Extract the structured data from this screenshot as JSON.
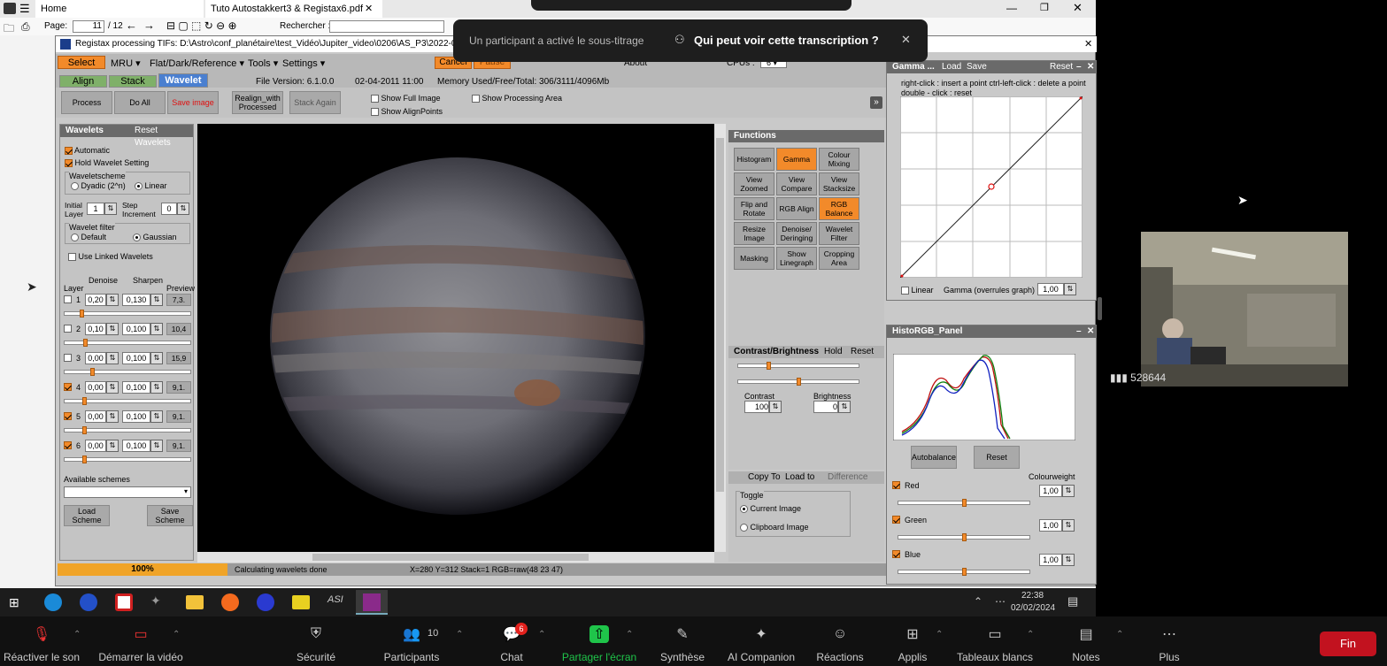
{
  "pdf": {
    "tabs": [
      {
        "label": "Home"
      },
      {
        "label": "Tuto Autostakkert3 & Registax6.pdf"
      }
    ],
    "page_label": "Page:",
    "page_value": "11",
    "page_total": "/ 12",
    "search_label": "Rechercher :"
  },
  "registax": {
    "title": "Registax processing TIFs: D:\\Astro\\conf_planétaire\\test_Vidéo\\Jupiter_video\\0206\\AS_P3\\2022-09-22",
    "menu": {
      "select": "Select",
      "mru": "MRU",
      "flat": "Flat/Dark/Reference",
      "tools": "Tools",
      "settings": "Settings",
      "cancel": "Cancel",
      "pause": "Pause",
      "about": "About",
      "cpus": "CPUs :",
      "cpus_value": "6"
    },
    "tabs": {
      "align": "Align",
      "stack": "Stack",
      "wavelet": "Wavelet"
    },
    "file_version": "File Version: 6.1.0.0",
    "date": "02-04-2011 11:00",
    "memory": "Memory Used/Free/Total: 306/3111/4096Mb",
    "toolbar": {
      "process": "Process",
      "do_all": "Do All",
      "save_image": "Save image",
      "realign1": "Realign_with",
      "realign2": "Processed",
      "stack_again": "Stack Again",
      "show_full": "Show Full Image",
      "show_align": "Show AlignPoints",
      "show_processing": "Show Processing Area"
    },
    "wavelets": {
      "title": "Wavelets",
      "reset": "Reset Wavelets",
      "automatic": "Automatic",
      "hold": "Hold Wavelet Setting",
      "scheme_title": "Waveletscheme",
      "dyadic": "Dyadic (2^n)",
      "linear": "Linear",
      "initial1": "Initial",
      "initial2": "Layer",
      "initial_value": "1",
      "step1": "Step",
      "step2": "Increment",
      "step_value": "0",
      "filter_title": "Wavelet filter",
      "default": "Default",
      "gaussian": "Gaussian",
      "use_linked": "Use Linked Wavelets",
      "col_layer": "Layer",
      "col_denoise": "Denoise",
      "col_sharpen": "Sharpen",
      "col_preview": "Preview",
      "layers": [
        {
          "n": "1",
          "denoise": "0,20",
          "sharpen": "0,130",
          "preview": "7,3.",
          "checked": false,
          "slider": 0.12
        },
        {
          "n": "2",
          "denoise": "0,10",
          "sharpen": "0,100",
          "preview": "10,4",
          "checked": false,
          "slider": 0.15
        },
        {
          "n": "3",
          "denoise": "0,00",
          "sharpen": "0,100",
          "preview": "15,9",
          "checked": false,
          "slider": 0.21
        },
        {
          "n": "4",
          "denoise": "0,00",
          "sharpen": "0,100",
          "preview": "9,1.",
          "checked": true,
          "slider": 0.14
        },
        {
          "n": "5",
          "denoise": "0,00",
          "sharpen": "0,100",
          "preview": "9,1.",
          "checked": true,
          "slider": 0.14
        },
        {
          "n": "6",
          "denoise": "0,00",
          "sharpen": "0,100",
          "preview": "9,1.",
          "checked": true,
          "slider": 0.14
        }
      ],
      "available": "Available schemes",
      "load1": "Load",
      "load2": "Scheme",
      "save1": "Save",
      "save2": "Scheme"
    },
    "functions": {
      "title": "Functions",
      "buttons": [
        [
          "Histogram",
          "Gamma",
          "Colour Mixing"
        ],
        [
          "View Zoomed",
          "View Compare",
          "View Stacksize"
        ],
        [
          "Flip and Rotate",
          "RGB Align",
          "RGB Balance"
        ],
        [
          "Resize Image",
          "Denoise/ Deringing",
          "Wavelet Filter"
        ],
        [
          "Masking",
          "Show Linegraph",
          "Cropping Area"
        ]
      ]
    },
    "contrast": {
      "title": "Contrast/Brightness",
      "hold": "Hold",
      "reset": "Reset",
      "contrast_label": "Contrast",
      "contrast_value": "100",
      "brightness_label": "Brightness",
      "brightness_value": "0"
    },
    "copy": {
      "copy_to": "Copy To",
      "load_to": "Load to",
      "difference": "Difference",
      "toggle": "Toggle",
      "current": "Current Image",
      "clipboard": "Clipboard Image"
    },
    "gamma": {
      "title": "Gamma ...",
      "load": "Load",
      "save": "Save",
      "reset": "Reset",
      "hint1": "right-click : insert a point  ctrl-left-click : delete a point",
      "hint2": "double - click : reset",
      "linear": "Linear",
      "overrule": "Gamma (overrules graph)",
      "value": "1,00"
    },
    "histo": {
      "title": "HistoRGB_Panel",
      "autobalance": "Autobalance",
      "reset": "Reset",
      "colourweight": "Colourweight",
      "channels": [
        {
          "name": "Red",
          "value": "1,00"
        },
        {
          "name": "Green",
          "value": "1,00"
        },
        {
          "name": "Blue",
          "value": "1,00"
        }
      ]
    },
    "status": {
      "progress": "100%",
      "message": "Calculating wavelets done",
      "coords": "X=280 Y=312 Stack=1 RGB=raw(48 23 47)"
    }
  },
  "notification": {
    "text": "Un participant a activé le sous-titrage",
    "action": "Qui peut voir cette transcription ?"
  },
  "video": {
    "signal": "528644"
  },
  "taskbar": {
    "time": "22:38",
    "date": "02/02/2024"
  },
  "zoom": {
    "items": [
      {
        "label": "Réactiver le son",
        "icon": "mic-muted-icon"
      },
      {
        "label": "Démarrer la vidéo",
        "icon": "video-off-icon"
      },
      {
        "label": "Sécurité",
        "icon": "shield-icon"
      },
      {
        "label": "Participants",
        "icon": "participants-icon",
        "count": "10"
      },
      {
        "label": "Chat",
        "icon": "chat-icon",
        "badge": "6"
      },
      {
        "label": "Partager l'écran",
        "icon": "share-screen-icon"
      },
      {
        "label": "Synthèse",
        "icon": "summary-icon"
      },
      {
        "label": "AI Companion",
        "icon": "sparkle-icon"
      },
      {
        "label": "Réactions",
        "icon": "emoji-icon"
      },
      {
        "label": "Applis",
        "icon": "apps-icon"
      },
      {
        "label": "Tableaux blancs",
        "icon": "whiteboard-icon"
      },
      {
        "label": "Notes",
        "icon": "notes-icon"
      },
      {
        "label": "Plus",
        "icon": "more-icon"
      }
    ],
    "end": "Fin",
    "colors": {
      "share": "#1fc44a",
      "end": "#c2121f",
      "badge": "#e3211d"
    }
  }
}
